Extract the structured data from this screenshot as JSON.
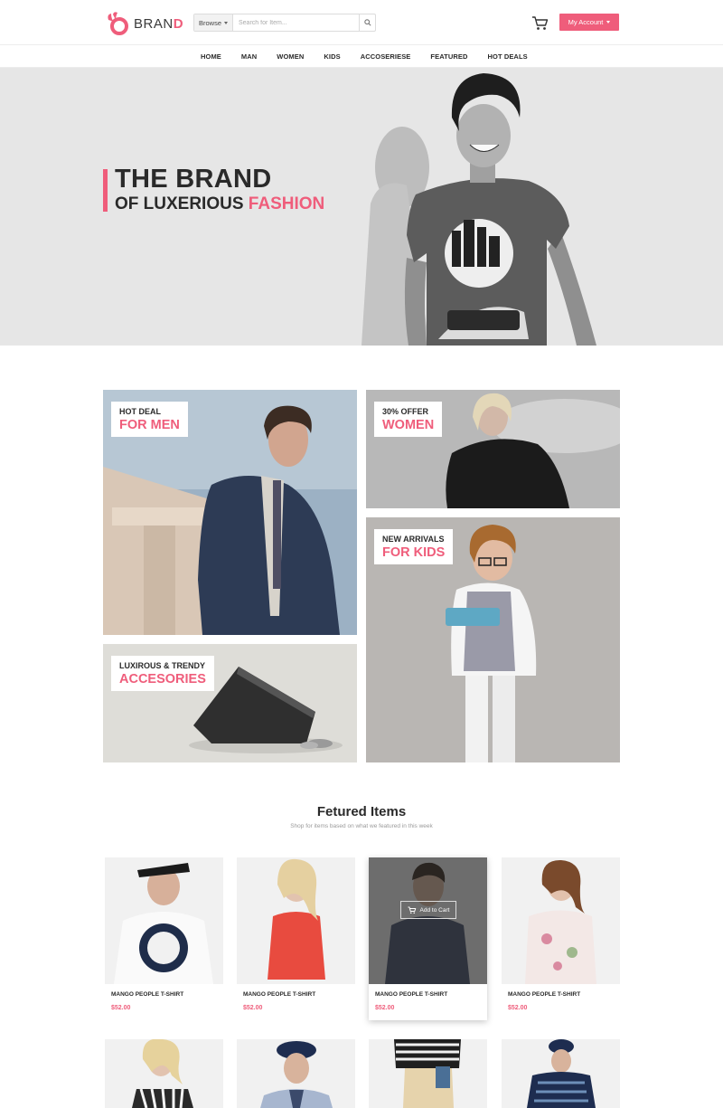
{
  "brand": {
    "name_main": "BRAN",
    "name_accent": "D"
  },
  "search": {
    "browse_label": "Browse",
    "placeholder": "Search for Item..."
  },
  "account": {
    "label": "My Account"
  },
  "nav": {
    "items": [
      "HOME",
      "MAN",
      "WOMEN",
      "KIDS",
      "ACCOSERIESE",
      "FEATURED",
      "HOT DEALS"
    ]
  },
  "hero": {
    "title": "THE BRAND",
    "subtitle_main": "OF LUXERIOUS ",
    "subtitle_accent": "FASHION"
  },
  "promos": {
    "men": {
      "small": "HOT DEAL",
      "big": "FOR MEN"
    },
    "women": {
      "small": "30% OFFER",
      "big": "WOMEN"
    },
    "kids": {
      "small": "NEW ARRIVALS",
      "big": "FOR KIDS"
    },
    "accessories": {
      "small": "LUXIROUS & TRENDY",
      "big": "ACCESORIES"
    }
  },
  "featured": {
    "title": "Fetured Items",
    "subtitle": "Shop for items based on what we featured in this week",
    "add_to_cart": "Add to Cart",
    "products": [
      {
        "name": "MANGO PEOPLE T-SHIRT",
        "price": "$52.00"
      },
      {
        "name": "MANGO PEOPLE T-SHIRT",
        "price": "$52.00"
      },
      {
        "name": "MANGO PEOPLE T-SHIRT",
        "price": "$52.00"
      },
      {
        "name": "MANGO PEOPLE T-SHIRT",
        "price": "$52.00"
      }
    ]
  },
  "colors": {
    "accent": "#ef5d7b",
    "text": "#2a2a2a",
    "hero_bg": "#e6e6e6"
  },
  "icons": [
    "logo-icon",
    "search-icon",
    "cart-icon",
    "chevron-down-icon"
  ]
}
